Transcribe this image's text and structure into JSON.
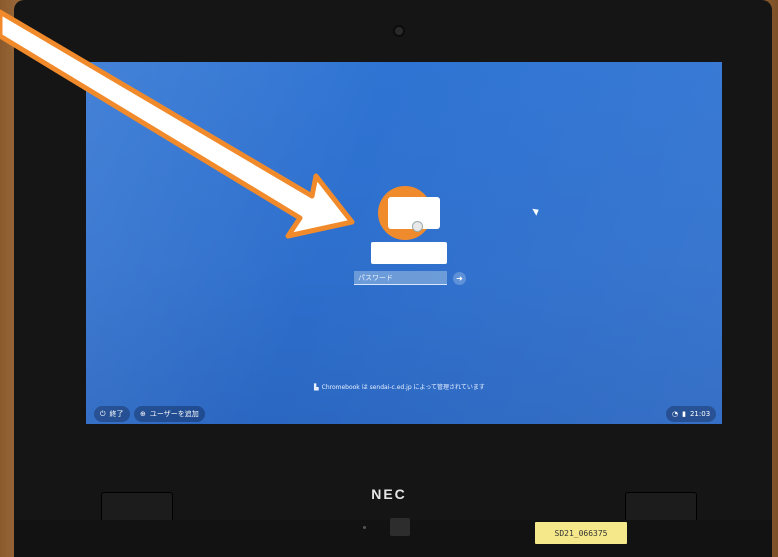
{
  "login": {
    "password_placeholder": "パスワード",
    "submit_icon": "arrow-right-icon",
    "managed_notice": "Chromebook は sendai-c.ed.jp によって管理されています"
  },
  "shelf": {
    "shutdown_label": "終了",
    "add_user_label": "ユーザーを追加",
    "time": "21:03"
  },
  "device": {
    "brand": "NEC",
    "asset_tag": "SD21_066375"
  },
  "colors": {
    "screen_blue": "#2f74d3",
    "avatar_orange": "#f08a2b",
    "arrow_orange": "#f08a2b"
  }
}
